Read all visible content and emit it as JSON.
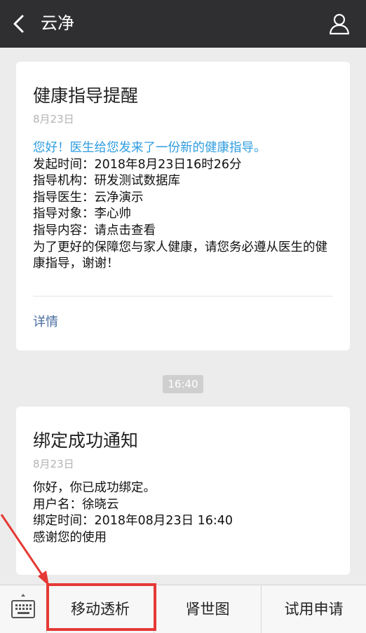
{
  "header": {
    "back_icon": "chevron-left-icon",
    "title": "云净",
    "profile_icon": "user-icon"
  },
  "messages": [
    {
      "title": "健康指导提醒",
      "date": "8月23日",
      "greeting": "您好！医生给您发来了一份新的健康指导。",
      "lines": [
        "发起时间：2018年8月23日16时26分",
        "指导机构：研发测试数据库",
        "指导医生：云净演示",
        "指导对象：李心帅",
        "指导内容：请点击查看"
      ],
      "closing": "为了更好的保障您与家人健康，请您务必遵从医生的健康指导，谢谢！",
      "details_label": "详情"
    },
    {
      "timestamp": "16:40",
      "title": "绑定成功通知",
      "date": "8月23日",
      "lines": [
        "你好，你已成功绑定。",
        "用户名：徐晓云",
        "绑定时间：2018年08月23日 16:40",
        "感谢您的使用"
      ]
    }
  ],
  "bottom_menu": {
    "keyboard_icon": "keyboard-icon",
    "items": [
      {
        "label": "移动透析"
      },
      {
        "label": "肾世图"
      },
      {
        "label": "试用申请"
      }
    ]
  },
  "annotation": {
    "highlight_color": "#e53935",
    "highlighted_item": "移动透析"
  },
  "colors": {
    "header_bg": "#2f2f31",
    "link_blue": "#2f9de0",
    "details_link": "#4a6da0"
  }
}
